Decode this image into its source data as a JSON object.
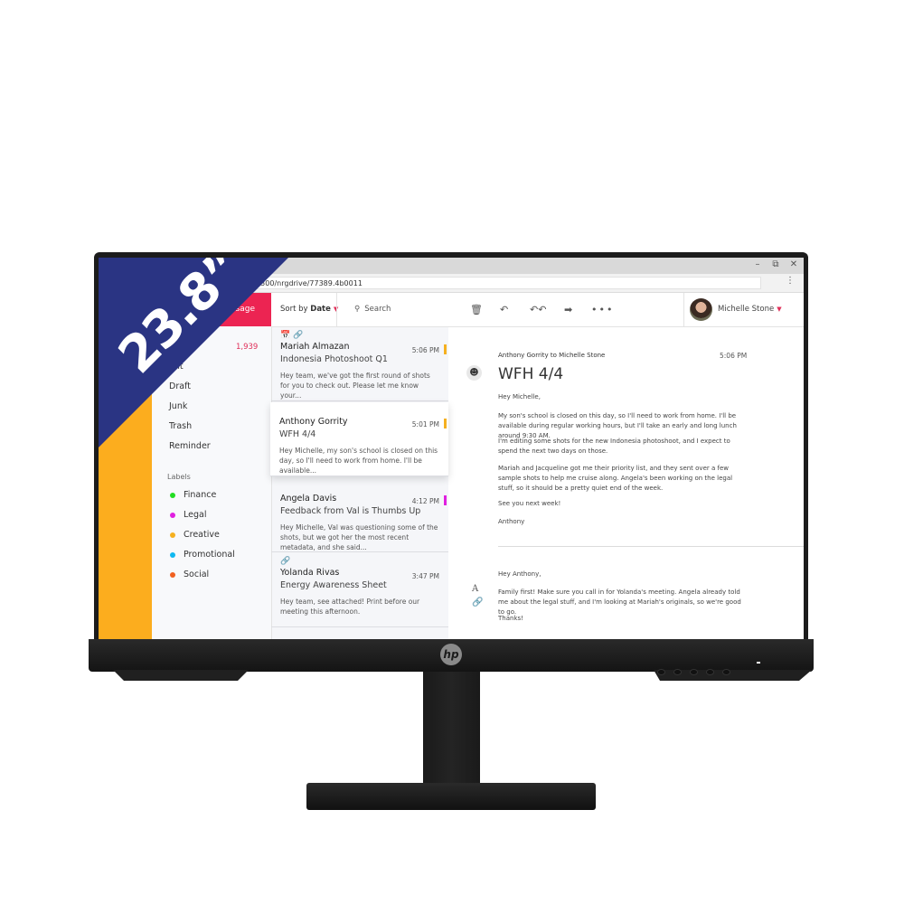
{
  "badge": {
    "size_text": "23.8”",
    "color": "#2a3483"
  },
  "window": {
    "controls": [
      "minimize",
      "restore",
      "close"
    ],
    "address": "10300/nrgdrive/77389.4b0011"
  },
  "sidebar": {
    "new_message_label": "New Message",
    "new_message_visible": "ssage",
    "inbox_count": "1,939",
    "folders": [
      "Sent",
      "Draft",
      "Junk",
      "Trash",
      "Reminder"
    ],
    "folder_first_visible": "ent",
    "labels_title": "Labels",
    "labels": [
      {
        "name": "Finance",
        "color": "#22dd22"
      },
      {
        "name": "Legal",
        "color": "#e020e0"
      },
      {
        "name": "Creative",
        "color": "#f5b020"
      },
      {
        "name": "Promotional",
        "color": "#10b8f0"
      },
      {
        "name": "Social",
        "color": "#f06020"
      }
    ],
    "accent_color": "#ec2452",
    "stripe_color": "#fcad1e"
  },
  "list": {
    "sort_prefix": "Sort by",
    "sort_value": "Date",
    "search_placeholder": "Search",
    "messages": [
      {
        "sender": "Mariah Almazan",
        "time": "5:06 PM",
        "subject": "Indonesia Photoshoot Q1",
        "preview": "Hey team, we've got the first round of shots for you to check out. Please let me know your...",
        "icons": "calendar-icon link-icon",
        "flag_color": "#f5b020"
      },
      {
        "sender": "Anthony Gorrity",
        "time": "5:01 PM",
        "subject": "WFH 4/4",
        "preview": "Hey Michelle, my son's school is closed on this day, so I'll need to work from home. I'll be available...",
        "flag_color": "#f5b020"
      },
      {
        "sender": "Angela Davis",
        "time": "4:12 PM",
        "subject": "Feedback from Val is Thumbs Up",
        "preview": "Hey Michelle, Val was questioning some of the shots, but we got her the most recent metadata, and she said...",
        "flag_color": "#e020e0"
      },
      {
        "sender": "Yolanda Rivas",
        "time": "3:47 PM",
        "subject": "Energy Awareness Sheet",
        "preview": "Hey team, see attached! Print before our meeting this afternoon.",
        "icons": "link-icon"
      }
    ]
  },
  "toolbar": {
    "icons": [
      "trash-icon",
      "reply-icon",
      "reply-all-icon",
      "forward-icon",
      "more-icon"
    ],
    "user_name": "Michelle Stone"
  },
  "reading": {
    "meta": "Anthony Gorrity to Michelle Stone",
    "time": "5:06 PM",
    "title": "WFH 4/4",
    "body": [
      "Hey Michelle,",
      "My son's school is closed on this day, so I'll need to work from home. I'll be available during regular working hours, but I'll take an early and long lunch around 9:30 AM.",
      "I'm editing some shots for the new Indonesia photoshoot, and I expect to spend the next two days on those.",
      "Mariah and Jacqueline got me their priority list, and they sent over a few sample shots to help me cruise along. Angela's been working on the legal stuff, so it should be a pretty quiet end of the week.",
      "See you next week!",
      "Anthony"
    ],
    "reply": [
      "Hey Anthony,",
      "Family first! Make sure you call in for Yolanda's meeting. Angela already told me about the legal stuff, and I'm looking at Mariah's originals, so we're good to go.",
      "Thanks!"
    ]
  },
  "monitor": {
    "brand": "hp"
  }
}
